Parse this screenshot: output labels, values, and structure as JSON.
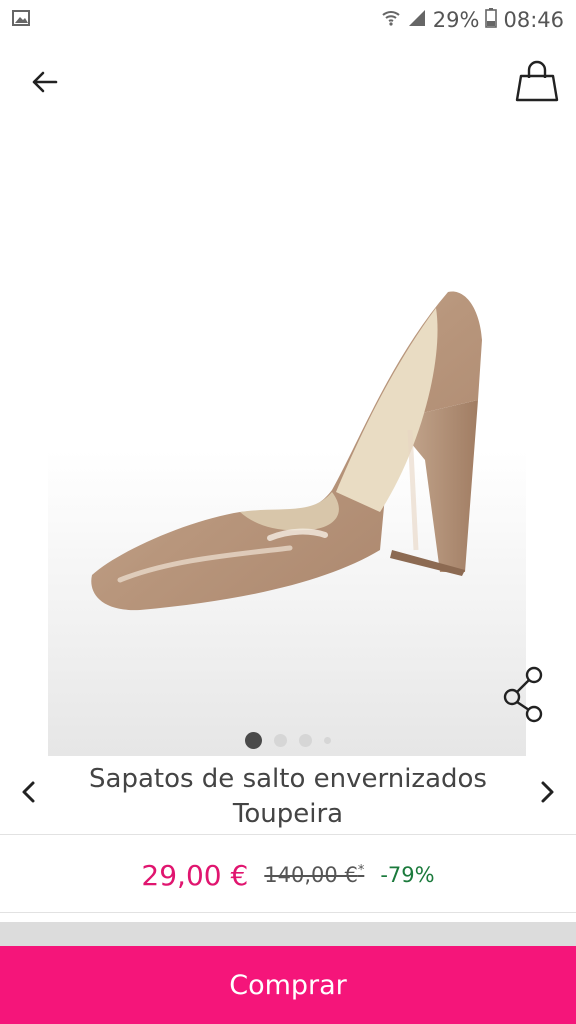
{
  "status": {
    "battery": "29%",
    "time": "08:46"
  },
  "product": {
    "title_line1": "Sapatos de salto envernizados",
    "title_line2": "Toupeira",
    "image_count": 4,
    "active_image": 1
  },
  "price": {
    "current": "29,00 €",
    "original": "140,00 €",
    "original_mark": "*",
    "discount": "-79%"
  },
  "actions": {
    "buy_label": "Comprar"
  },
  "icons": [
    "image-icon",
    "wifi-icon",
    "signal-icon",
    "battery-icon",
    "back-arrow-icon",
    "shopping-bag-icon",
    "share-icon",
    "chevron-left-icon",
    "chevron-right-icon"
  ],
  "colors": {
    "accent": "#f5157a",
    "price": "#e0156f",
    "discount": "#1b7a3c"
  }
}
